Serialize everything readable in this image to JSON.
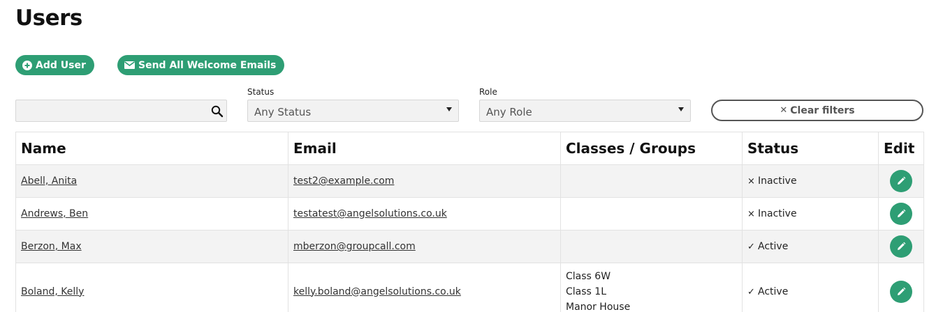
{
  "page": {
    "title": "Users"
  },
  "actions": {
    "add_user_label": "Add User",
    "send_welcome_label": "Send All Welcome Emails"
  },
  "filters": {
    "search_placeholder": "",
    "status_label": "Status",
    "status_value": "Any Status",
    "role_label": "Role",
    "role_value": "Any Role",
    "clear_label": "Clear filters"
  },
  "table": {
    "headers": [
      "Name",
      "Email",
      "Classes / Groups",
      "Status",
      "Edit"
    ],
    "rows": [
      {
        "name": "Abell, Anita",
        "email": "test2@example.com",
        "groups": [],
        "status_icon": "×",
        "status": "Inactive"
      },
      {
        "name": "Andrews, Ben",
        "email": "testatest@angelsolutions.co.uk",
        "groups": [],
        "status_icon": "×",
        "status": "Inactive"
      },
      {
        "name": "Berzon, Max",
        "email": "mberzon@groupcall.com",
        "groups": [],
        "status_icon": "✓",
        "status": "Active"
      },
      {
        "name": "Boland, Kelly",
        "email": "kelly.boland@angelsolutions.co.uk",
        "groups": [
          "Class 6W",
          "Class 1L",
          "Manor House"
        ],
        "status_icon": "✓",
        "status": "Active"
      }
    ]
  },
  "colors": {
    "accent": "#2e9e74",
    "row_alt": "#f3f3f3",
    "border": "#e2e2e2"
  },
  "icons": {
    "add": "plus-circle-icon",
    "mail": "envelope-icon",
    "search": "search-icon",
    "caret": "caret-down-icon",
    "clear": "close-icon",
    "edit": "pencil-icon"
  }
}
